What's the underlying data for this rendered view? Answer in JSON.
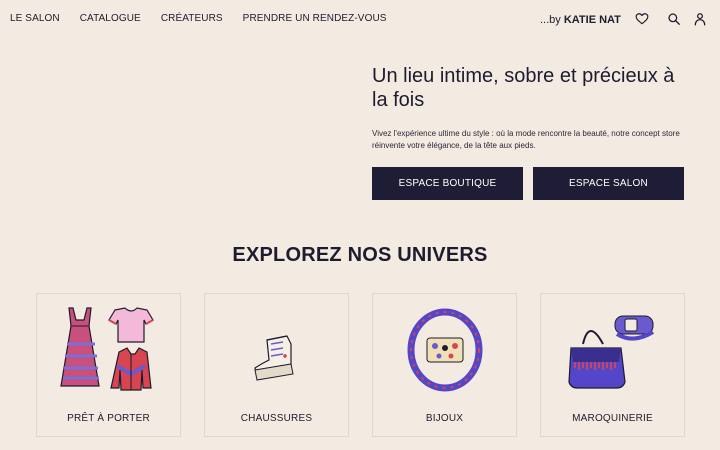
{
  "nav": {
    "links": [
      "LE SALON",
      "CATALOGUE",
      "CRÉATEURS",
      "PRENDRE UN RENDEZ-VOUS"
    ],
    "brand_prefix": "...by",
    "brand_name": "KATIE NAT",
    "icons": [
      "heart-icon",
      "search-icon",
      "user-icon"
    ]
  },
  "hero": {
    "title": "Un lieu intime, sobre et précieux à la fois",
    "text": "Vivez l'expérience ultime du style : où la mode rencontre la beauté, notre concept store réinvente votre élégance, de la tête aux pieds.",
    "button_boutique": "ESPACE BOUTIQUE",
    "button_salon": "ESPACE SALON"
  },
  "univers": {
    "title": "EXPLOREZ NOS UNIVERS",
    "cards": [
      {
        "label": "PRÊT À PORTER",
        "icon": "clothing-icon"
      },
      {
        "label": "CHAUSSURES",
        "icon": "sneaker-icon"
      },
      {
        "label": "BIJOUX",
        "icon": "necklace-icon"
      },
      {
        "label": "MAROQUINERIE",
        "icon": "handbag-icon"
      }
    ]
  },
  "colors": {
    "background": "#f3ebe2",
    "button": "#1f1d35",
    "text": "#1e1b2e",
    "accent_purple": "#6a5acd",
    "accent_red": "#d64550",
    "accent_pink": "#f4b8d8"
  }
}
